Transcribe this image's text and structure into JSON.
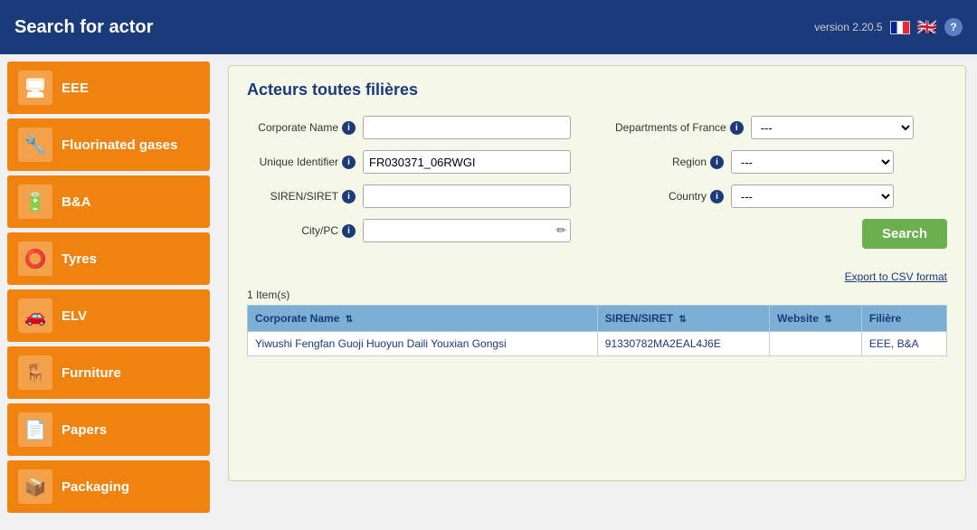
{
  "header": {
    "title": "Search for actor",
    "version": "version 2.20.5",
    "help_label": "?"
  },
  "sidebar": {
    "items": [
      {
        "id": "eee",
        "label": "EEE",
        "icon": "🖥"
      },
      {
        "id": "fluorinated",
        "label": "Fluorinated gases",
        "icon": "🔧"
      },
      {
        "id": "ba",
        "label": "B&A",
        "icon": "🔋"
      },
      {
        "id": "tyres",
        "label": "Tyres",
        "icon": "⭕"
      },
      {
        "id": "elv",
        "label": "ELV",
        "icon": "🚗"
      },
      {
        "id": "furniture",
        "label": "Furniture",
        "icon": "🪑"
      },
      {
        "id": "papers",
        "label": "Papers",
        "icon": "📄"
      },
      {
        "id": "packaging",
        "label": "Packaging",
        "icon": "📦"
      }
    ]
  },
  "content": {
    "section_title": "Acteurs toutes filières",
    "form": {
      "corporate_name_label": "Corporate Name",
      "unique_identifier_label": "Unique Identifier",
      "siren_siret_label": "SIREN/SIRET",
      "city_pc_label": "City/PC",
      "departments_label": "Departments of France",
      "region_label": "Region",
      "country_label": "Country",
      "corporate_name_value": "",
      "unique_identifier_value": "FR030371_06RWGI",
      "siren_siret_value": "",
      "city_pc_value": "",
      "departments_value": "---",
      "region_value": "---",
      "country_value": "---",
      "departments_options": [
        "---"
      ],
      "region_options": [
        "---"
      ],
      "country_options": [
        "---"
      ]
    },
    "search_button": "Search",
    "export_link": "Export to CSV format",
    "item_count": "1 Item(s)",
    "table": {
      "columns": [
        {
          "key": "corporate_name",
          "label": "Corporate Name"
        },
        {
          "key": "siren_siret",
          "label": "SIREN/SIRET"
        },
        {
          "key": "website",
          "label": "Website"
        },
        {
          "key": "filiere",
          "label": "Filière"
        }
      ],
      "rows": [
        {
          "corporate_name": "Yiwushi Fengfan Guoji Huoyun Daili Youxian Gongsi",
          "siren_siret": "91330782MA2EAL4J6E",
          "website": "",
          "filiere": "EEE, B&A"
        }
      ]
    }
  }
}
